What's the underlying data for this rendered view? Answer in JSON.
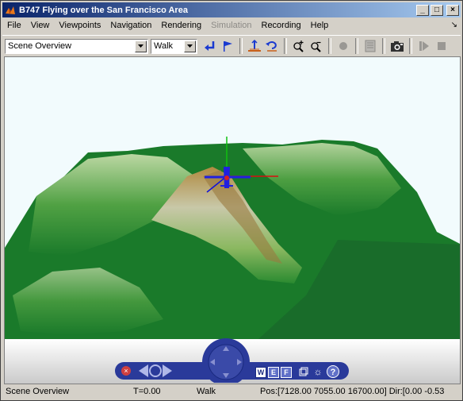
{
  "window": {
    "title": "B747 Flying over the San Francisco Area",
    "minimize_label": "_",
    "maximize_label": "□",
    "close_label": "×"
  },
  "menu": {
    "items": [
      {
        "label": "File",
        "enabled": true
      },
      {
        "label": "View",
        "enabled": true
      },
      {
        "label": "Viewpoints",
        "enabled": true
      },
      {
        "label": "Navigation",
        "enabled": true
      },
      {
        "label": "Rendering",
        "enabled": true
      },
      {
        "label": "Simulation",
        "enabled": false
      },
      {
        "label": "Recording",
        "enabled": true
      },
      {
        "label": "Help",
        "enabled": true
      }
    ]
  },
  "toolbar": {
    "viewpoint_select": "Scene Overview",
    "navigation_select": "Walk",
    "icons": [
      "return-to-viewpoint-icon",
      "create-viewpoint-icon",
      "straighten-up-icon",
      "undo-move-icon",
      "zoom-in-icon",
      "zoom-out-icon",
      "record-icon",
      "record-settings-icon",
      "capture-frame-icon",
      "play-icon",
      "stop-icon"
    ]
  },
  "nav_panel": {
    "walk_label": "W",
    "examine_label": "E",
    "fly_label": "F",
    "help_label": "?"
  },
  "status": {
    "viewpoint": "Scene Overview",
    "time": "T=0.00",
    "mode": "Walk",
    "position": "Pos:[7128.00 7055.00 16700.00] Dir:[0.00 -0.53"
  },
  "colors": {
    "title_gradient_start": "#0a246a",
    "title_gradient_end": "#a6caf0",
    "terrain_green": "#1a7a2a",
    "nav_panel_blue": "#2a3a9a"
  }
}
